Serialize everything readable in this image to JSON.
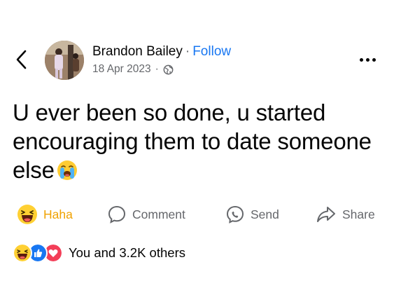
{
  "header": {
    "back_icon": "chevron-left-icon",
    "author_name": "Brandon Bailey",
    "separator": "·",
    "follow_label": "Follow",
    "date": "18 Apr 2023",
    "meta_separator": "·",
    "privacy_icon": "globe-icon",
    "more_icon": "more-horizontal-icon"
  },
  "post": {
    "text": "U ever been so done, u started encouraging them to date someone else",
    "trailing_emoji": "loudly-crying-face-emoji"
  },
  "actions": {
    "haha_label": "Haha",
    "comment_label": "Comment",
    "send_label": "Send",
    "share_label": "Share"
  },
  "reactions": {
    "icons": [
      "haha-icon",
      "like-icon",
      "love-icon"
    ],
    "summary": "You and 3.2K others"
  },
  "colors": {
    "follow_blue": "#1877f2",
    "haha_yellow": "#f0a200",
    "like_blue": "#1877f2",
    "love_red": "#f33e58",
    "muted": "#65676b"
  }
}
